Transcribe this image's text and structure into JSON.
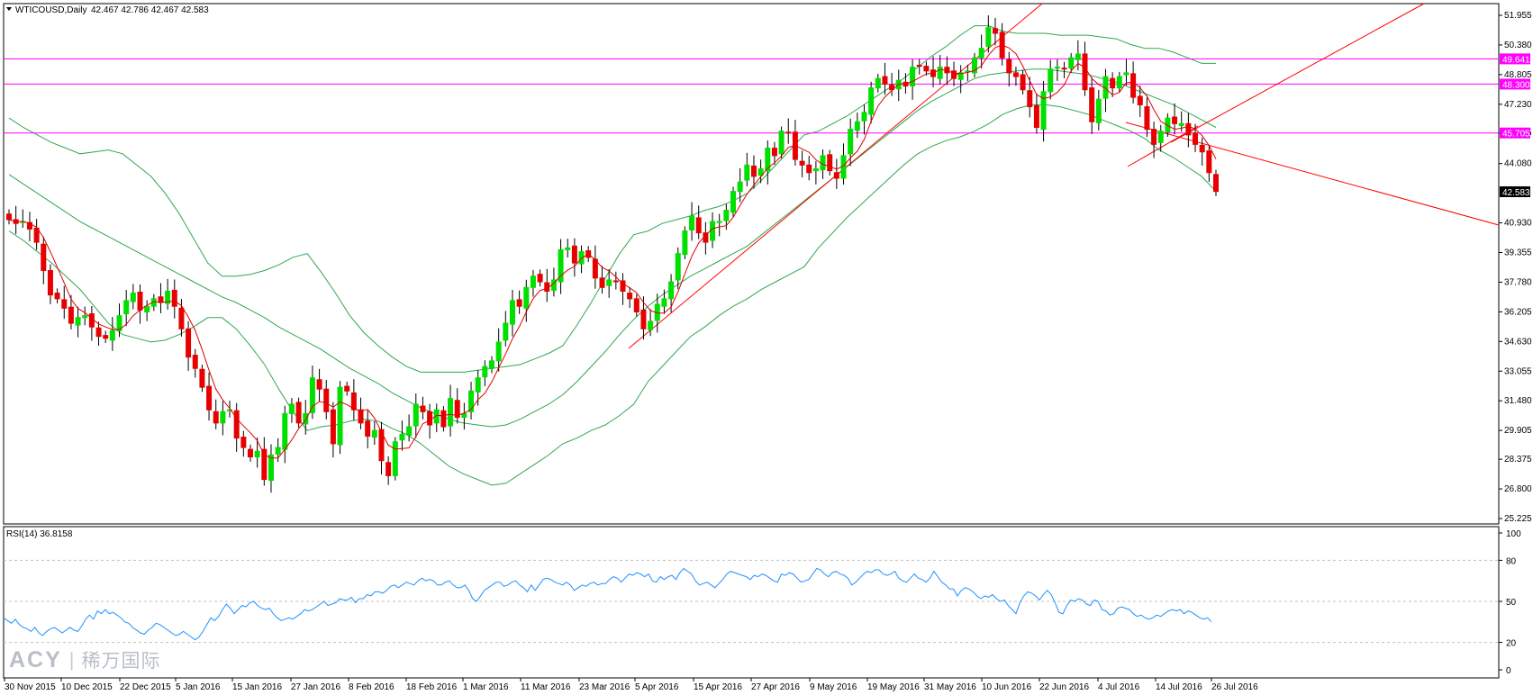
{
  "header": {
    "symbol": "WTICOUSD,Daily",
    "ohlc": "42.467 42.786 42.467 42.583",
    "rsi_label": "RSI(14) 36.8158"
  },
  "watermark": {
    "brand": "ACY",
    "separator": "|",
    "cn": "稀万国际"
  },
  "colors": {
    "bull": "#00e000",
    "bear": "#e80000",
    "bollinger": "#2fa84f",
    "moving_average": "#e00000",
    "trendline": "#ff0000",
    "level_line": "#ff00ff",
    "rsi_line": "#1e90ff",
    "grid": "#c0c0c0"
  },
  "chart_data": {
    "type": "candlestick",
    "title": "WTICOUSD,Daily",
    "ylim": [
      25.225,
      52.6
    ],
    "y_ticks": [
      "51.955",
      "50.380",
      "48.805",
      "47.230",
      "45.705",
      "44.080",
      "42.583",
      "40.930",
      "39.355",
      "37.780",
      "36.205",
      "34.630",
      "33.055",
      "31.480",
      "29.905",
      "28.375",
      "26.800",
      "25.225"
    ],
    "x_ticks": [
      "30 Nov 2015",
      "10 Dec 2015",
      "22 Dec 2015",
      "5 Jan 2016",
      "15 Jan 2016",
      "27 Jan 2016",
      "8 Feb 2016",
      "18 Feb 2016",
      "1 Mar 2016",
      "11 Mar 2016",
      "23 Mar 2016",
      "5 Apr 2016",
      "15 Apr 2016",
      "27 Apr 2016",
      "9 May 2016",
      "19 May 2016",
      "31 May 2016",
      "10 Jun 2016",
      "22 Jun 2016",
      "4 Jul 2016",
      "14 Jul 2016",
      "26 Jul 2016"
    ],
    "close": [
      41.1,
      40.9,
      41.0,
      40.6,
      39.9,
      38.4,
      37.1,
      36.9,
      36.4,
      35.6,
      35.9,
      36.0,
      35.4,
      34.9,
      34.8,
      35.2,
      36.0,
      36.8,
      37.2,
      36.3,
      36.5,
      36.9,
      36.7,
      37.3,
      36.5,
      35.3,
      33.8,
      33.2,
      32.2,
      31.0,
      30.3,
      30.9,
      31.0,
      29.5,
      29.0,
      28.5,
      28.8,
      27.3,
      28.6,
      29.0,
      30.8,
      31.3,
      30.3,
      30.8,
      32.7,
      32.1,
      30.9,
      29.2,
      32.2,
      32.0,
      31.0,
      30.3,
      29.6,
      29.9,
      28.3,
      27.5,
      29.3,
      29.7,
      30.1,
      31.3,
      30.9,
      30.2,
      31.0,
      30.1,
      31.6,
      30.6,
      30.8,
      32.0,
      32.7,
      33.3,
      33.6,
      34.6,
      35.6,
      36.8,
      36.5,
      37.5,
      38.1,
      37.8,
      37.3,
      37.9,
      39.5,
      39.6,
      38.8,
      39.4,
      39.1,
      38.0,
      37.5,
      37.9,
      37.8,
      37.3,
      36.9,
      36.2,
      35.3,
      35.7,
      36.6,
      36.9,
      37.8,
      39.3,
      40.5,
      41.3,
      40.4,
      39.9,
      41.0,
      41.0,
      41.6,
      42.6,
      43.1,
      44.0,
      43.4,
      43.8,
      44.9,
      44.5,
      45.8,
      45.7,
      44.3,
      44.0,
      43.6,
      43.8,
      44.5,
      43.7,
      43.3,
      44.5,
      45.9,
      46.3,
      46.8,
      48.1,
      48.6,
      48.3,
      48.0,
      48.5,
      48.2,
      49.2,
      49.3,
      49.0,
      48.7,
      49.2,
      48.9,
      48.6,
      48.9,
      49.0,
      49.7,
      50.2,
      51.3,
      51.0,
      49.7,
      48.9,
      48.7,
      48.0,
      47.1,
      46.0,
      47.9,
      49.1,
      49.2,
      49.1,
      49.7,
      49.9,
      48.0,
      46.3,
      47.5,
      48.7,
      48.1,
      48.7,
      48.9,
      47.6,
      47.2,
      45.9,
      45.1,
      45.8,
      46.5,
      46.2,
      46.2,
      45.6,
      45.1,
      44.7,
      43.6,
      42.6
    ],
    "bollinger_upper": [
      46.5,
      46.0,
      45.6,
      45.2,
      44.9,
      44.6,
      44.7,
      44.8,
      44.6,
      44.0,
      43.4,
      42.5,
      41.4,
      40.1,
      38.8,
      38.1,
      38.1,
      38.2,
      38.4,
      38.7,
      39.1,
      39.3,
      38.3,
      37.2,
      36.0,
      35.1,
      34.4,
      33.8,
      33.3,
      33.0,
      33.0,
      33.0,
      33.0,
      33.1,
      33.2,
      33.3,
      33.4,
      33.7,
      34.0,
      34.4,
      35.5,
      36.7,
      38.0,
      39.3,
      40.3,
      40.5,
      40.9,
      41.1,
      41.3,
      41.6,
      41.8,
      42.1,
      42.5,
      43.2,
      44.0,
      44.8,
      45.6,
      45.8,
      46.2,
      46.6,
      47.1,
      47.6,
      48.1,
      48.6,
      49.2,
      49.8,
      50.3,
      50.9,
      51.4,
      51.4,
      51.1,
      51.0,
      51.0,
      51.0,
      50.9,
      50.9,
      50.9,
      50.8,
      50.7,
      50.4,
      50.2,
      50.2,
      50.0,
      49.7,
      49.4,
      49.4
    ],
    "bollinger_middle": [
      43.5,
      43.0,
      42.5,
      42.0,
      41.5,
      41.0,
      40.6,
      40.2,
      39.8,
      39.4,
      39.0,
      38.6,
      38.2,
      37.8,
      37.4,
      37.0,
      36.7,
      36.3,
      35.9,
      35.4,
      35.0,
      34.6,
      34.2,
      33.7,
      33.2,
      32.8,
      32.4,
      31.9,
      31.5,
      31.1,
      30.8,
      30.5,
      30.3,
      30.2,
      30.1,
      30.2,
      30.5,
      30.9,
      31.3,
      31.8,
      32.5,
      33.3,
      34.1,
      35.0,
      35.8,
      36.5,
      37.1,
      37.6,
      38.1,
      38.5,
      38.9,
      39.3,
      39.7,
      40.3,
      40.9,
      41.5,
      42.1,
      42.7,
      43.3,
      43.9,
      44.5,
      45.1,
      45.7,
      46.3,
      46.9,
      47.4,
      47.8,
      48.2,
      48.6,
      48.8,
      48.9,
      49.0,
      49.1,
      49.1,
      49.0,
      48.9,
      48.8,
      48.6,
      48.4,
      48.1,
      47.8,
      47.5,
      47.2,
      46.8,
      46.4,
      46.0
    ],
    "bollinger_lower": [
      40.5,
      40.0,
      39.4,
      38.8,
      38.1,
      37.4,
      36.5,
      35.6,
      35.0,
      34.8,
      34.6,
      34.7,
      35.0,
      35.4,
      35.9,
      35.9,
      35.3,
      34.4,
      33.4,
      32.1,
      30.9,
      29.9,
      30.1,
      30.2,
      30.4,
      30.5,
      30.4,
      30.0,
      29.7,
      29.2,
      28.6,
      28.0,
      27.6,
      27.3,
      27.0,
      27.1,
      27.6,
      28.1,
      28.6,
      29.2,
      29.5,
      29.9,
      30.2,
      30.7,
      31.3,
      32.5,
      33.3,
      34.1,
      34.9,
      35.4,
      36.0,
      36.5,
      36.9,
      37.4,
      37.8,
      38.2,
      38.6,
      39.6,
      40.4,
      41.2,
      41.9,
      42.6,
      43.3,
      44.0,
      44.6,
      45.0,
      45.3,
      45.5,
      45.8,
      46.2,
      46.7,
      47.0,
      47.2,
      47.2,
      47.1,
      46.9,
      46.7,
      46.4,
      46.1,
      45.8,
      45.4,
      44.8,
      44.4,
      43.9,
      43.4,
      42.6
    ],
    "horizontal_levels": [
      49.641,
      48.3,
      45.705
    ],
    "last_price": 42.583,
    "rsi": {
      "name": "RSI(14) 36.8158",
      "ylim": [
        0,
        100
      ],
      "levels": [
        20,
        50,
        80
      ],
      "ticks": [
        "100",
        "80",
        "50",
        "20",
        "0"
      ],
      "values": [
        38,
        36,
        34,
        37,
        33,
        31,
        30,
        28,
        31,
        27,
        25,
        28,
        30,
        31,
        29,
        27,
        29,
        31,
        29,
        28,
        32,
        37,
        40,
        37,
        43,
        41,
        44,
        41,
        42,
        40,
        38,
        35,
        34,
        31,
        29,
        27,
        26,
        29,
        31,
        34,
        33,
        31,
        29,
        27,
        25,
        26,
        28,
        26,
        24,
        22,
        24,
        28,
        33,
        38,
        36,
        39,
        44,
        48,
        45,
        41,
        44,
        47,
        46,
        49,
        50,
        47,
        45,
        44,
        45,
        41,
        38,
        36,
        37,
        38,
        37,
        39,
        41,
        44,
        43,
        44,
        46,
        48,
        50,
        47,
        48,
        49,
        52,
        51,
        51,
        53,
        49,
        52,
        52,
        55,
        54,
        57,
        57,
        56,
        58,
        61,
        62,
        60,
        62,
        64,
        63,
        62,
        65,
        67,
        65,
        66,
        65,
        62,
        62,
        64,
        65,
        62,
        60,
        60,
        62,
        58,
        52,
        50,
        54,
        58,
        60,
        62,
        64,
        64,
        61,
        62,
        64,
        65,
        62,
        60,
        57,
        62,
        58,
        62,
        66,
        67,
        66,
        64,
        63,
        62,
        64,
        62,
        58,
        60,
        62,
        61,
        63,
        64,
        62,
        63,
        63,
        66,
        68,
        67,
        64,
        67,
        70,
        69,
        71,
        70,
        68,
        70,
        65,
        64,
        68,
        66,
        68,
        69,
        66,
        71,
        74,
        72,
        70,
        65,
        62,
        63,
        64,
        62,
        60,
        63,
        66,
        70,
        72,
        71,
        70,
        69,
        68,
        66,
        69,
        68,
        70,
        69,
        67,
        65,
        64,
        70,
        69,
        71,
        70,
        67,
        64,
        65,
        66,
        70,
        74,
        73,
        70,
        68,
        71,
        72,
        70,
        69,
        67,
        62,
        64,
        67,
        70,
        72,
        71,
        73,
        73,
        70,
        69,
        70,
        72,
        67,
        65,
        64,
        67,
        70,
        67,
        66,
        64,
        67,
        72,
        68,
        64,
        62,
        59,
        59,
        54,
        58,
        60,
        59,
        57,
        54,
        52,
        54,
        53,
        55,
        52,
        50,
        51,
        47,
        44,
        41,
        49,
        54,
        57,
        56,
        54,
        51,
        55,
        58,
        55,
        49,
        42,
        41,
        47,
        51,
        50,
        52,
        51,
        48,
        47,
        51,
        50,
        44,
        43,
        40,
        41,
        45,
        46,
        45,
        44,
        41,
        39,
        40,
        38,
        37,
        38,
        40,
        39,
        41,
        43,
        44,
        43,
        44,
        41,
        43,
        42,
        40,
        38,
        37,
        38,
        35
      ]
    }
  }
}
